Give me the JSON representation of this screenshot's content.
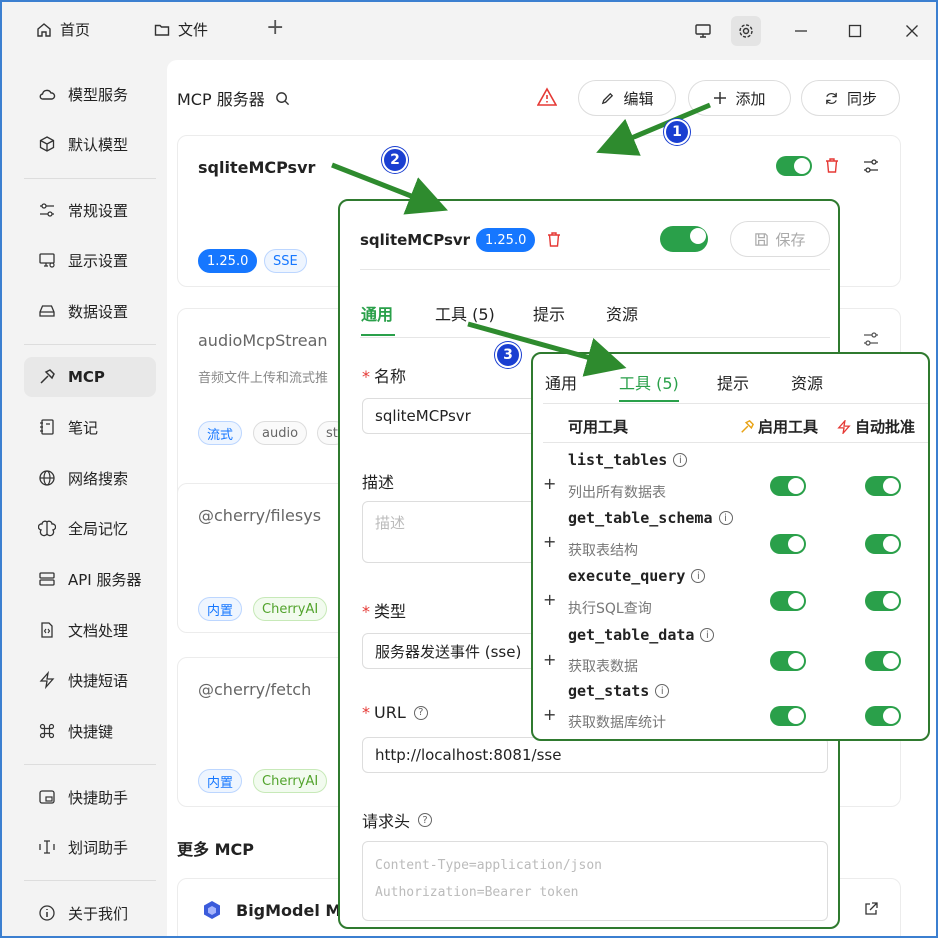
{
  "titlebar": {
    "tab_home": "首页",
    "tab_files": "文件",
    "add_tab": "+"
  },
  "sidebar": {
    "items": [
      {
        "label": "模型服务"
      },
      {
        "label": "默认模型"
      },
      {
        "label": "常规设置"
      },
      {
        "label": "显示设置"
      },
      {
        "label": "数据设置"
      },
      {
        "label": "MCP"
      },
      {
        "label": "笔记"
      },
      {
        "label": "网络搜索"
      },
      {
        "label": "全局记忆"
      },
      {
        "label": "API 服务器"
      },
      {
        "label": "文档处理"
      },
      {
        "label": "快捷短语"
      },
      {
        "label": "快捷键"
      },
      {
        "label": "快捷助手"
      },
      {
        "label": "划词助手"
      },
      {
        "label": "关于我们"
      }
    ]
  },
  "main": {
    "title": "MCP 服务器",
    "btn_edit": "编辑",
    "btn_add": "添加",
    "btn_sync": "同步",
    "cards": [
      {
        "title": "sqliteMCPsvr",
        "tags": [
          "1.25.0",
          "SSE"
        ]
      },
      {
        "title": "audioMcpStrean",
        "desc": "音频文件上传和流式推",
        "tags": [
          "流式",
          "audio",
          "st"
        ]
      },
      {
        "title": "@cherry/filesys",
        "tags": [
          "内置",
          "CherryAI"
        ]
      },
      {
        "title": "@cherry/fetch",
        "tags": [
          "内置",
          "CherryAI"
        ]
      }
    ],
    "more_title": "更多 MCP",
    "more_item": "BigModel M"
  },
  "panel1": {
    "title": "sqliteMCPsvr",
    "version": "1.25.0",
    "save": "保存",
    "tabs": [
      "通用",
      "工具 (5)",
      "提示",
      "资源"
    ],
    "name_label": "名称",
    "name_value": "sqliteMCPsvr",
    "desc_label": "描述",
    "desc_placeholder": "描述",
    "type_label": "类型",
    "type_value": "服务器发送事件 (sse)",
    "url_label": "URL",
    "url_value": "http://localhost:8081/sse",
    "headers_label": "请求头",
    "headers_placeholder_1": "Content-Type=application/json",
    "headers_placeholder_2": "Authorization=Bearer token"
  },
  "panel2": {
    "tabs": [
      "通用",
      "工具 (5)",
      "提示",
      "资源"
    ],
    "col_tools": "可用工具",
    "col_enable": "启用工具",
    "col_auto": "自动批准",
    "tools": [
      {
        "name": "list_tables",
        "desc": "列出所有数据表"
      },
      {
        "name": "get_table_schema",
        "desc": "获取表结构"
      },
      {
        "name": "execute_query",
        "desc": "执行SQL查询"
      },
      {
        "name": "get_table_data",
        "desc": "获取表数据"
      },
      {
        "name": "get_stats",
        "desc": "获取数据库统计"
      }
    ]
  },
  "annotations": [
    "1",
    "2",
    "3"
  ],
  "colors": {
    "accent_green": "#2aa04a",
    "tag_blue": "#1677ff",
    "arrow_green": "#2e8b2e",
    "badge_blue": "#1a3fd1"
  }
}
